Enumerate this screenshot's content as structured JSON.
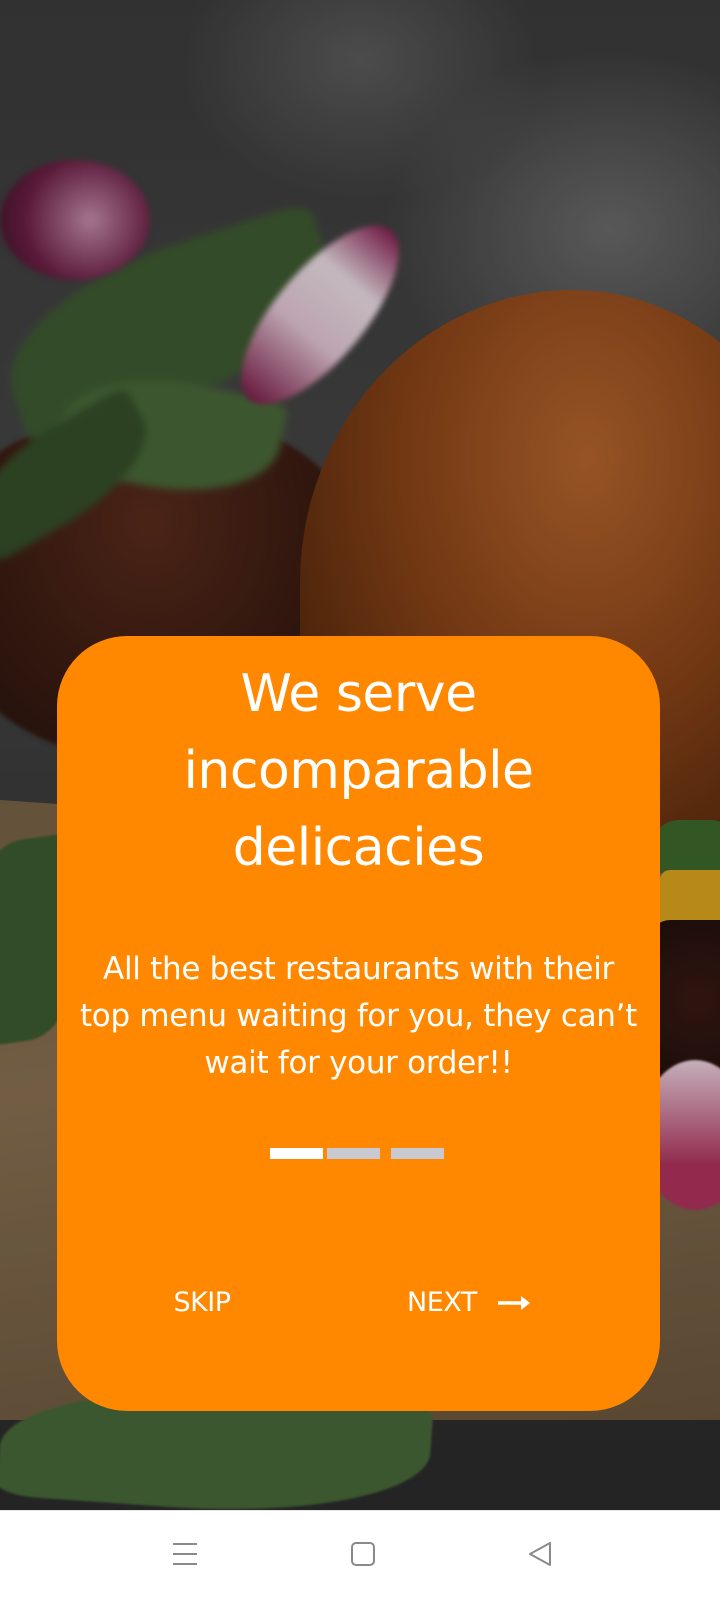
{
  "onboarding": {
    "title_lines": [
      "We serve",
      "incomparable",
      "delicacies"
    ],
    "subtitle_lines": [
      "All the best restaurants with their",
      "top menu waiting for you, they can’t",
      "wait for your order!!"
    ],
    "page_indicator": {
      "active_index": 0,
      "count": 3,
      "active_color": "#ffffff",
      "inactive_color": "#c9c9d1"
    },
    "skip_label": "SKIP",
    "next_label": "NEXT",
    "next_icon": "arrow-right-icon",
    "card_color": "#ff8800"
  },
  "system_nav": {
    "menu_icon": "menu-lines-icon",
    "home_icon": "home-square-icon",
    "back_icon": "back-triangle-icon"
  }
}
